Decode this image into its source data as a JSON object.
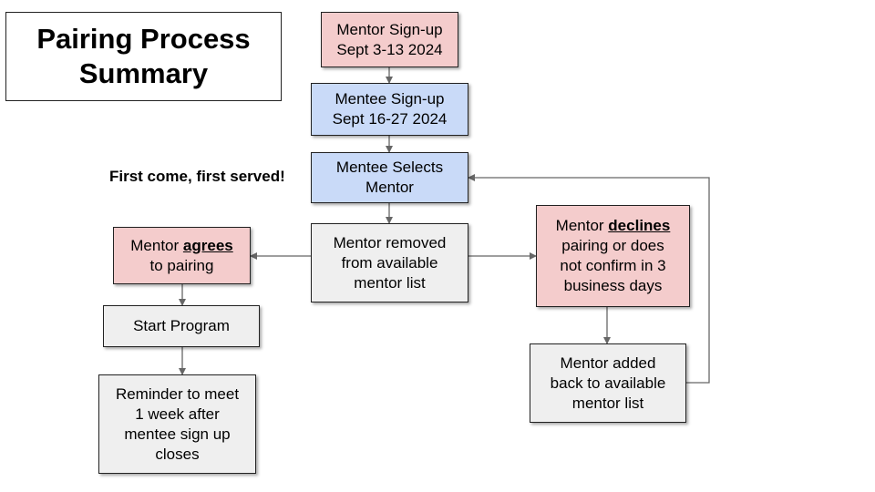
{
  "title": {
    "line1": "Pairing Process",
    "line2": "Summary"
  },
  "note": "First come, first served!",
  "colors": {
    "pink": "#f4cccc",
    "blue": "#c9daf8",
    "grey": "#efefef",
    "connector": "#666666"
  },
  "nodes": {
    "mentor_signup": {
      "line1": "Mentor Sign-up",
      "line2": "Sept 3-13 2024"
    },
    "mentee_signup": {
      "line1": "Mentee Sign-up",
      "line2": "Sept 16-27 2024"
    },
    "mentee_selects": {
      "line1": "Mentee Selects",
      "line2": "Mentor"
    },
    "mentor_removed": {
      "line1": "Mentor removed",
      "line2": "from available",
      "line3": "mentor list"
    },
    "mentor_agrees": {
      "prefix": "Mentor ",
      "emphasis": "agrees",
      "line2": "to pairing"
    },
    "start_program": {
      "line1": "Start Program"
    },
    "reminder": {
      "line1": "Reminder to meet",
      "line2": "1 week after",
      "line3": "mentee sign up",
      "line4": "closes"
    },
    "mentor_declines": {
      "prefix": "Mentor ",
      "emphasis": "declines",
      "line2": "pairing or does",
      "line3": "not confirm in 3",
      "line4": "business days"
    },
    "mentor_added_back": {
      "line1": "Mentor added",
      "line2": "back to available",
      "line3": "mentor list"
    }
  }
}
